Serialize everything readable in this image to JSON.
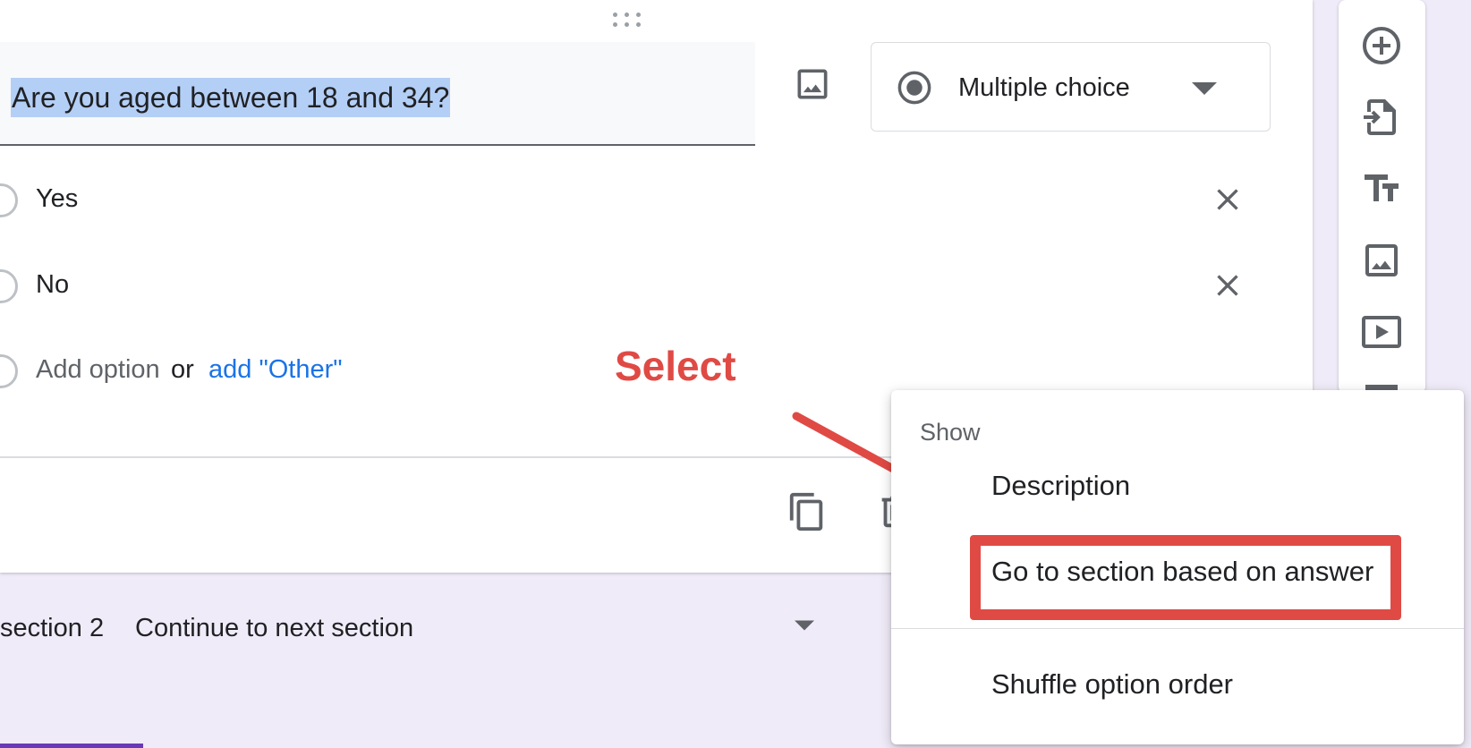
{
  "question": {
    "title": "Are you aged between 18 and 34?",
    "type_label": "Multiple choice",
    "options": [
      {
        "label": "Yes"
      },
      {
        "label": "No"
      }
    ],
    "add_option_label": "Add option",
    "or_label": "or",
    "add_other_label": "add \"Other\""
  },
  "section_navigation": {
    "label": "section 2",
    "value": "Continue to next section"
  },
  "annotation": {
    "text": "Select",
    "color": "#e04a44"
  },
  "menu": {
    "header": "Show",
    "items": [
      {
        "label": "Description"
      },
      {
        "label": "Go to section based on answer",
        "highlighted": true
      },
      {
        "label": "Shuffle option order"
      }
    ]
  },
  "toolbar": {
    "tools": [
      "add-question-icon",
      "import-questions-icon",
      "add-title-icon",
      "add-image-icon",
      "add-video-icon"
    ]
  },
  "colors": {
    "accent": "#673ab7",
    "link": "#1a73e8",
    "selection_highlight": "#b4cff6",
    "background": "#f0ebf8"
  }
}
